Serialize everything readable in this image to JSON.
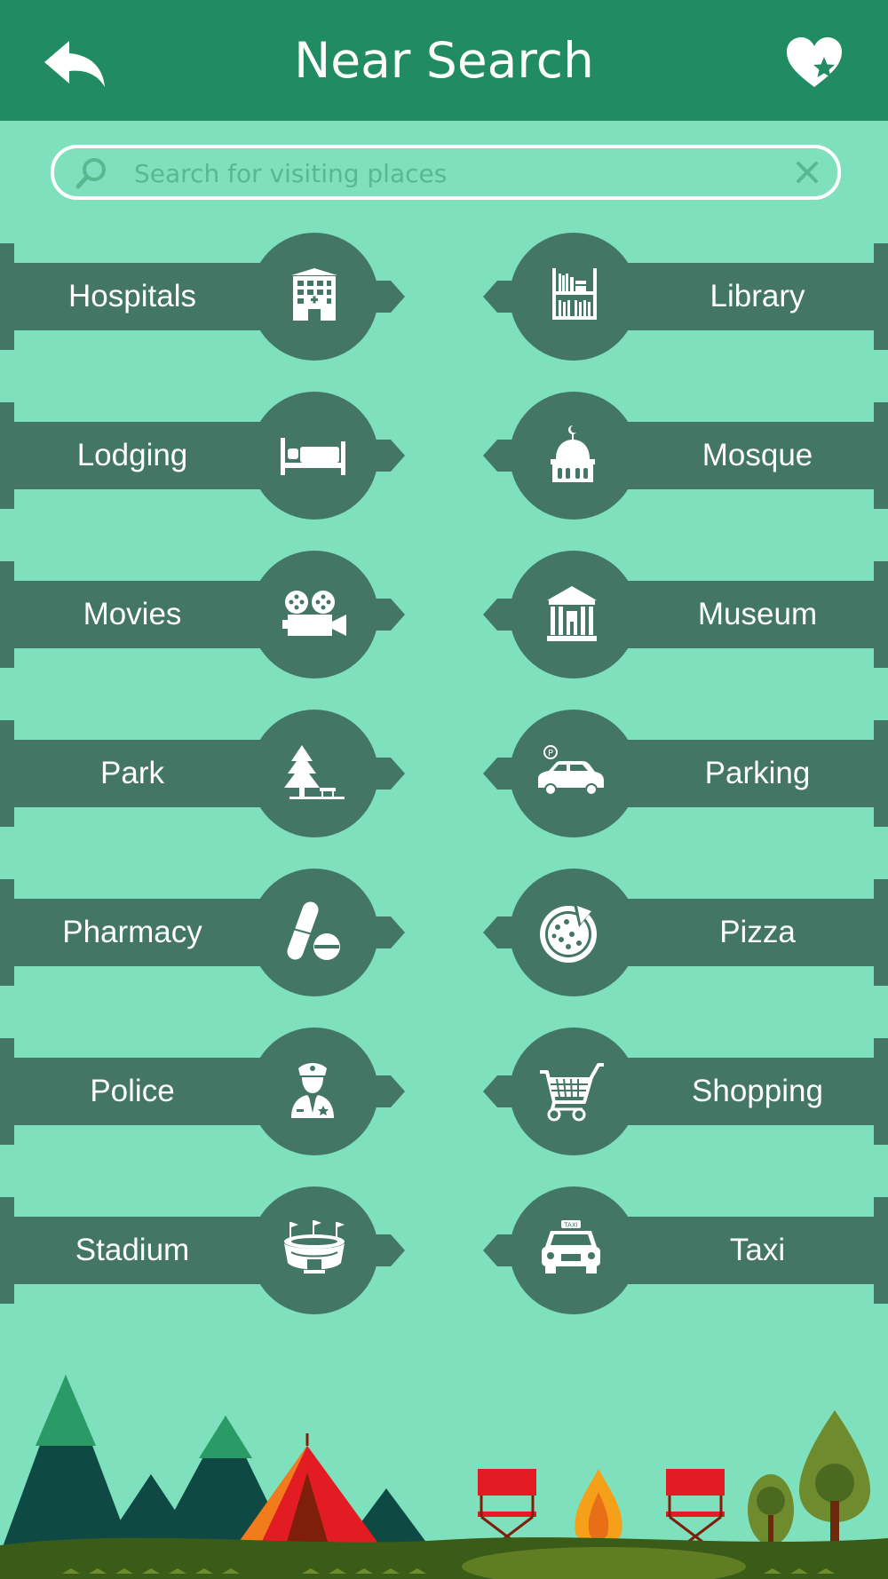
{
  "header": {
    "title": "Near Search",
    "back_icon": "back-arrow-icon",
    "favorites_icon": "heart-star-icon"
  },
  "search": {
    "placeholder": "Search for visiting places",
    "value": ""
  },
  "colors": {
    "header": "#218c63",
    "background": "#7ee0bd",
    "ribbon": "#437665",
    "text": "#ffffff"
  },
  "categories": [
    {
      "label": "Hospitals",
      "icon": "hospital-icon"
    },
    {
      "label": "Library",
      "icon": "library-icon"
    },
    {
      "label": "Lodging",
      "icon": "bed-icon"
    },
    {
      "label": "Mosque",
      "icon": "mosque-icon"
    },
    {
      "label": "Movies",
      "icon": "movie-camera-icon"
    },
    {
      "label": "Museum",
      "icon": "museum-icon"
    },
    {
      "label": "Park",
      "icon": "park-tree-icon"
    },
    {
      "label": "Parking",
      "icon": "parking-car-icon"
    },
    {
      "label": "Pharmacy",
      "icon": "pills-icon"
    },
    {
      "label": "Pizza",
      "icon": "pizza-icon"
    },
    {
      "label": "Police",
      "icon": "police-officer-icon"
    },
    {
      "label": "Shopping",
      "icon": "shopping-cart-icon"
    },
    {
      "label": "Stadium",
      "icon": "stadium-icon"
    },
    {
      "label": "Taxi",
      "icon": "taxi-icon"
    }
  ]
}
